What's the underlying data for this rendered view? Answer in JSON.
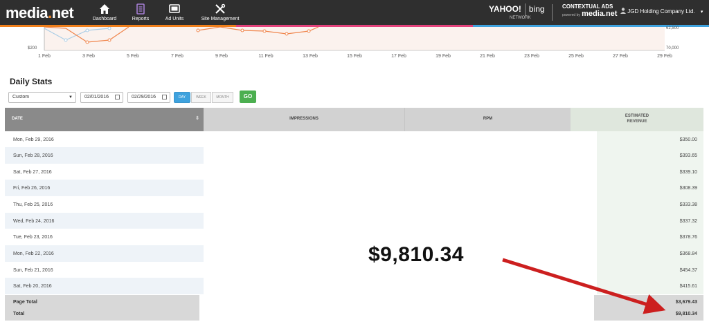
{
  "header": {
    "logo_main": "media",
    "logo_dot": ".",
    "logo_tail": "net",
    "nav": [
      {
        "label": "Dashboard",
        "icon": "home-icon"
      },
      {
        "label": "Reports",
        "icon": "report-icon"
      },
      {
        "label": "Ad Units",
        "icon": "ad-units-icon"
      },
      {
        "label": "Site Management",
        "icon": "tools-icon"
      }
    ],
    "partner_yahoo": "YAHOO!",
    "partner_bing": "bing",
    "partner_network": "NETWORK",
    "contextual": "CONTEXTUAL ADS",
    "powered": "powered by",
    "powered_brand": "media.net",
    "user": "JGD Holding Company Ltd."
  },
  "chart_data": {
    "type": "line",
    "x_ticks": [
      "1 Feb",
      "3 Feb",
      "5 Feb",
      "7 Feb",
      "9 Feb",
      "11 Feb",
      "13 Feb",
      "15 Feb",
      "17 Feb",
      "19 Feb",
      "21 Feb",
      "23 Feb",
      "25 Feb",
      "27 Feb",
      "29 Feb"
    ],
    "y_left_label": "$200",
    "y_right_labels": [
      "70,000",
      "62,500"
    ],
    "colors": {
      "series_a": "#f0854c",
      "series_b": "#a9cde6"
    }
  },
  "stats": {
    "title": "Daily Stats",
    "range_select": "Custom",
    "start_date": "02/01/2016",
    "end_date": "02/29/2016",
    "granularity": [
      "DAY",
      "WEEK",
      "MONTH"
    ],
    "go": "GO"
  },
  "table": {
    "headers": {
      "date": "DATE",
      "impressions": "IMPRESSIONS",
      "rpm": "RPM",
      "revenue_1": "ESTIMATED",
      "revenue_2": "REVENUE"
    },
    "rows": [
      {
        "date": "Mon, Feb 29, 2016",
        "revenue": "$350.00"
      },
      {
        "date": "Sun, Feb 28, 2016",
        "revenue": "$393.65"
      },
      {
        "date": "Sat, Feb 27, 2016",
        "revenue": "$339.10"
      },
      {
        "date": "Fri, Feb 26, 2016",
        "revenue": "$308.39"
      },
      {
        "date": "Thu, Feb 25, 2016",
        "revenue": "$333.38"
      },
      {
        "date": "Wed, Feb 24, 2016",
        "revenue": "$337.32"
      },
      {
        "date": "Tue, Feb 23, 2016",
        "revenue": "$378.76"
      },
      {
        "date": "Mon, Feb 22, 2016",
        "revenue": "$368.84"
      },
      {
        "date": "Sun, Feb 21, 2016",
        "revenue": "$454.37"
      },
      {
        "date": "Sat, Feb 20, 2016",
        "revenue": "$415.61"
      }
    ],
    "page_total_label": "Page Total",
    "page_total_value": "$3,679.43",
    "total_label": "Total",
    "total_value": "$9,810.34"
  },
  "annotation": {
    "big_total": "$9,810.34",
    "arrow_color": "#cc1f1f"
  }
}
